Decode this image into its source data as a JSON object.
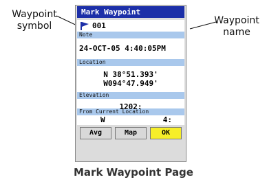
{
  "callouts": {
    "symbol_line1": "Waypoint",
    "symbol_line2": "symbol",
    "name_line1": "Waypoint",
    "name_line2": "name"
  },
  "screen": {
    "title": "Mark Waypoint",
    "symbol_icon": "flag-icon",
    "name_value": "001",
    "note_label": "Note",
    "note_value": "24-OCT-05 4:40:05PM",
    "location_label": "Location",
    "lat": "N  38°51.393'",
    "lon": "W094°47.949'",
    "elevation_label": "Elevation",
    "elevation_value": "1202:",
    "from_label": "From Current Location",
    "from_dir": "W",
    "from_dist": "4:",
    "buttons": {
      "avg": "Avg",
      "map": "Map",
      "ok": "OK"
    }
  },
  "caption": "Mark Waypoint Page",
  "colors": {
    "titlebar": "#1c2fa8",
    "label_band": "#a9c8ec",
    "ok_button": "#f6ee29",
    "flag": "#1c2fa8"
  }
}
